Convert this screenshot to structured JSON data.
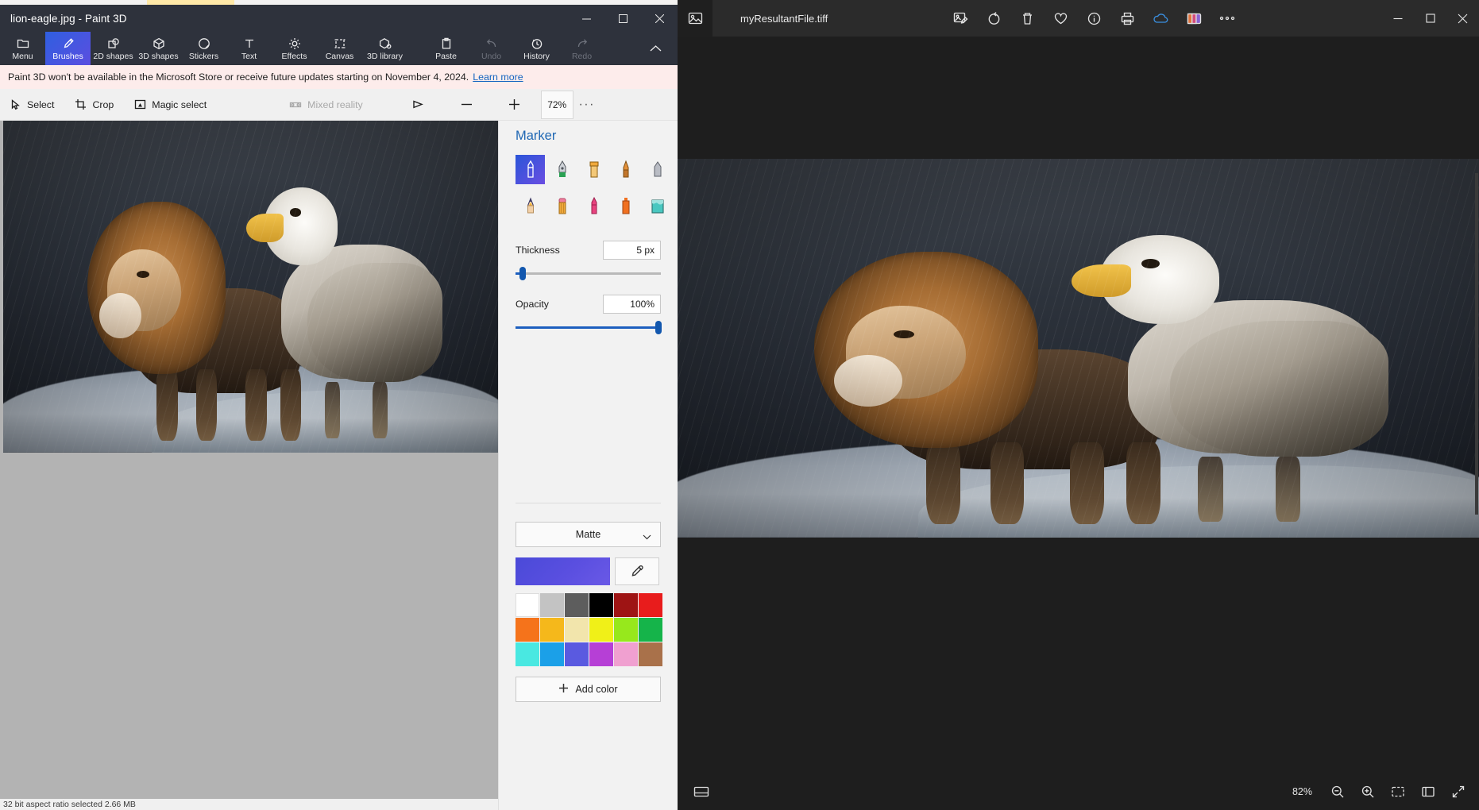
{
  "paint3d": {
    "title": "lion-eagle.jpg - Paint 3D",
    "window_controls": {
      "minimize": "minimize-icon",
      "maximize": "maximize-icon",
      "close": "close-icon"
    },
    "ribbon": [
      {
        "label": "Menu",
        "icon": "folder-icon",
        "state": "normal"
      },
      {
        "label": "Brushes",
        "icon": "brush-icon",
        "state": "active"
      },
      {
        "label": "2D shapes",
        "icon": "2d-shapes-icon",
        "state": "normal"
      },
      {
        "label": "3D shapes",
        "icon": "3d-shapes-icon",
        "state": "normal"
      },
      {
        "label": "Stickers",
        "icon": "stickers-icon",
        "state": "normal"
      },
      {
        "label": "Text",
        "icon": "text-icon",
        "state": "normal"
      },
      {
        "label": "Effects",
        "icon": "effects-icon",
        "state": "normal"
      },
      {
        "label": "Canvas",
        "icon": "canvas-icon",
        "state": "normal"
      },
      {
        "label": "3D library",
        "icon": "3d-library-icon",
        "state": "normal"
      },
      {
        "label": "Paste",
        "icon": "paste-icon",
        "state": "normal"
      },
      {
        "label": "Undo",
        "icon": "undo-icon",
        "state": "disabled"
      },
      {
        "label": "History",
        "icon": "history-icon",
        "state": "normal"
      },
      {
        "label": "Redo",
        "icon": "redo-icon",
        "state": "disabled"
      }
    ],
    "banner": {
      "text": "Paint 3D won't be available in the Microsoft Store or receive future updates starting on November 4, 2024.",
      "link": "Learn more"
    },
    "subbar": {
      "select": "Select",
      "crop": "Crop",
      "magic_select": "Magic select",
      "mixed_reality": "Mixed reality",
      "zoom_value": "72%",
      "more": "···"
    },
    "panel": {
      "title": "Marker",
      "brushes": [
        {
          "name": "marker-brush",
          "selected": true
        },
        {
          "name": "calligraphy-pen-brush",
          "selected": false
        },
        {
          "name": "oil-brush",
          "selected": false
        },
        {
          "name": "watercolor-brush",
          "selected": false
        },
        {
          "name": "eraser-brush",
          "selected": false
        },
        {
          "name": "pencil-brush",
          "selected": false
        },
        {
          "name": "crayon-brush",
          "selected": false
        },
        {
          "name": "pixel-pen-brush",
          "selected": false
        },
        {
          "name": "spray-can-brush",
          "selected": false
        },
        {
          "name": "fill-bucket-brush",
          "selected": false
        }
      ],
      "thickness_label": "Thickness",
      "thickness_value": "5 px",
      "thickness_percent": 4,
      "opacity_label": "Opacity",
      "opacity_value": "100%",
      "opacity_percent": 100,
      "material": "Matte",
      "current_color": "#4f4ddc",
      "eyedropper": "eyedropper-icon",
      "swatches": [
        "#ffffff",
        "#c3c3c3",
        "#5d5d5d",
        "#000000",
        "#9e1414",
        "#e81c1c",
        "#f5731b",
        "#f5b81b",
        "#f2e5ac",
        "#f0f018",
        "#97e81c",
        "#15b44a",
        "#49e8e1",
        "#1ba0e8",
        "#5a5ae0",
        "#b63fd6",
        "#f0a0d0",
        "#a9714a"
      ],
      "add_color": "Add color"
    },
    "statusbar": "32 bit aspect ratio selected  2.66 MB"
  },
  "photos": {
    "filename": "myResultantFile.tiff",
    "thumb_icon": "image-thumbnail-icon",
    "toolbar": [
      {
        "name": "edit-image-icon"
      },
      {
        "name": "rotate-icon"
      },
      {
        "name": "delete-icon"
      },
      {
        "name": "favorite-icon"
      },
      {
        "name": "info-icon"
      },
      {
        "name": "print-icon"
      },
      {
        "name": "onedrive-icon"
      },
      {
        "name": "gallery-icon"
      },
      {
        "name": "more-options-icon"
      }
    ],
    "window_controls": {
      "minimize": "minimize-icon",
      "maximize": "maximize-icon",
      "close": "close-icon"
    },
    "bottombar": {
      "filmstrip": "filmstrip-icon",
      "zoom_value": "82%",
      "zoom_out": "zoom-out-icon",
      "zoom_in": "zoom-in-icon",
      "fit": "fit-to-window-icon",
      "actual_size": "actual-size-icon",
      "fullscreen": "fullscreen-icon"
    }
  }
}
